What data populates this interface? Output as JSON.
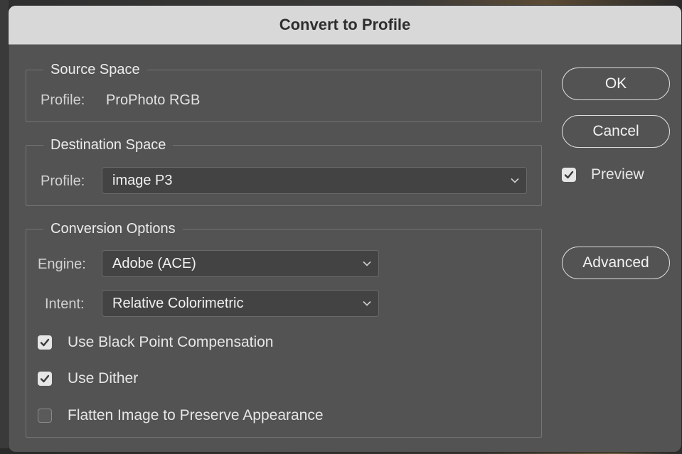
{
  "dialog": {
    "title": "Convert to Profile"
  },
  "source_space": {
    "legend": "Source Space",
    "profile_label": "Profile:",
    "profile_value": "ProPhoto RGB"
  },
  "destination_space": {
    "legend": "Destination Space",
    "profile_label": "Profile:",
    "profile_value": "image P3"
  },
  "conversion_options": {
    "legend": "Conversion Options",
    "engine_label": "Engine:",
    "engine_value": "Adobe (ACE)",
    "intent_label": "Intent:",
    "intent_value": "Relative Colorimetric",
    "checkboxes": [
      {
        "label": "Use Black Point Compensation",
        "checked": true
      },
      {
        "label": "Use Dither",
        "checked": true
      },
      {
        "label": "Flatten Image to Preserve Appearance",
        "checked": false
      }
    ]
  },
  "buttons": {
    "ok": "OK",
    "cancel": "Cancel",
    "advanced": "Advanced"
  },
  "preview": {
    "label": "Preview",
    "checked": true
  },
  "icons": {
    "checkmark": "checkmark-icon",
    "dropdown": "chevron-down-icon"
  },
  "colors": {
    "dialog_bg": "#535353",
    "titlebar_bg": "#d8d8d8",
    "field_bg": "#434343",
    "checkbox_on": "#e6e6e6"
  }
}
